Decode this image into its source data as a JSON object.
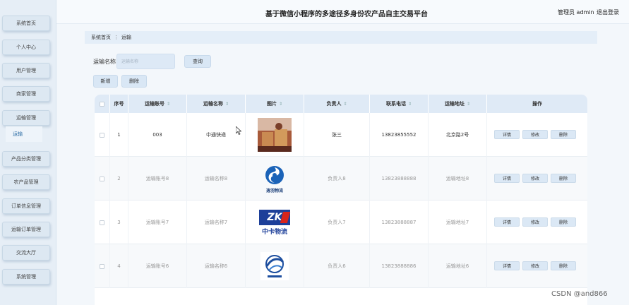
{
  "header": {
    "title": "基于微信小程序的多途径多身份农产品自主交易平台",
    "user": "管理员 admin",
    "logout": "退出登录"
  },
  "sidebar": {
    "items": [
      "系统首页",
      "个人中心",
      "用户管理",
      "商家管理",
      "运输管理",
      "产品分类管理",
      "农产品管理",
      "订单信息管理",
      "运输订单管理",
      "交流大厅",
      "系统管理"
    ],
    "active_sub": "运输"
  },
  "breadcrumb": {
    "home": "系统首页",
    "sep": "⋮",
    "current": "运输"
  },
  "search": {
    "label": "运输名称",
    "placeholder": "运输名称",
    "query_label": "查询"
  },
  "actions": {
    "add_label": "新增",
    "delete_label": "删除"
  },
  "table": {
    "columns": [
      "序号",
      "运输账号",
      "运输名称",
      "图片",
      "负责人",
      "联系电话",
      "运输地址",
      "操作"
    ],
    "row_ops": [
      "详情",
      "修改",
      "删除"
    ],
    "rows": [
      {
        "no": "1",
        "account": "003",
        "name": "中通快递",
        "manager": "张三",
        "phone": "13823855552",
        "address": "北京路2号"
      },
      {
        "no": "2",
        "account": "运输账号8",
        "name": "运输名称8",
        "manager": "负责人8",
        "phone": "13823888888",
        "address": "运输地址8",
        "logo_text": "逸羽物流"
      },
      {
        "no": "3",
        "account": "运输账号7",
        "name": "运输名称7",
        "manager": "负责人7",
        "phone": "13823888887",
        "address": "运输地址7",
        "logo_text": "ZK",
        "logo_sub": "中卡物流"
      },
      {
        "no": "4",
        "account": "运输账号6",
        "name": "运输名称6",
        "manager": "负责人6",
        "phone": "13823888886",
        "address": "运输地址6"
      }
    ]
  },
  "watermark": "CSDN @and866"
}
